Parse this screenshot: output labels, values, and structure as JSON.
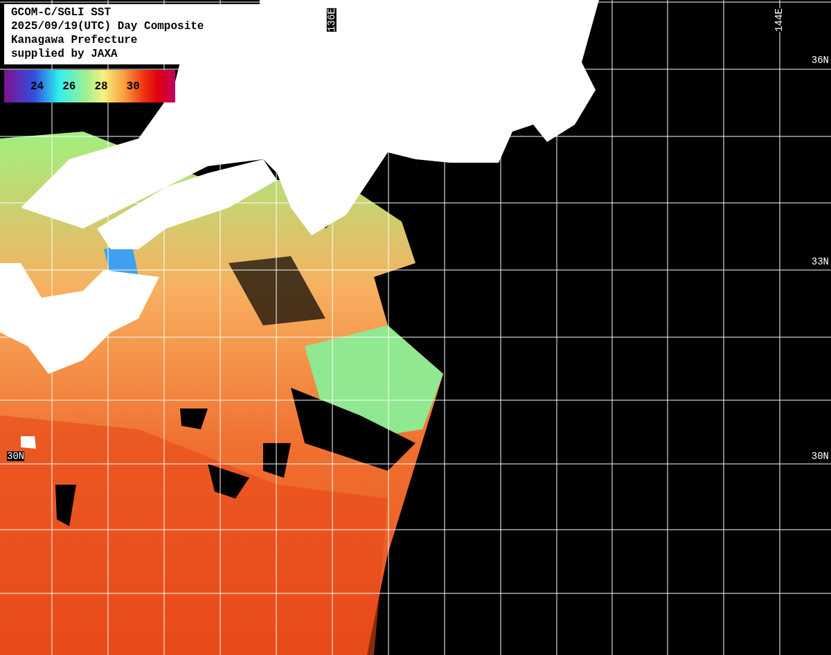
{
  "title_box": {
    "lines": [
      "GCOM-C/SGLI SST",
      "2025/09/19(UTC) Day Composite",
      "Kanagawa Prefecture",
      "supplied by JAXA"
    ]
  },
  "legend": {
    "ticks": [
      "24",
      "26",
      "28",
      "30"
    ]
  },
  "map": {
    "longitude_labels": [
      "136E",
      "144E"
    ],
    "left_latitude_labels": [
      "30N"
    ],
    "right_latitude_labels": [
      "36N",
      "33N",
      "30N"
    ]
  }
}
